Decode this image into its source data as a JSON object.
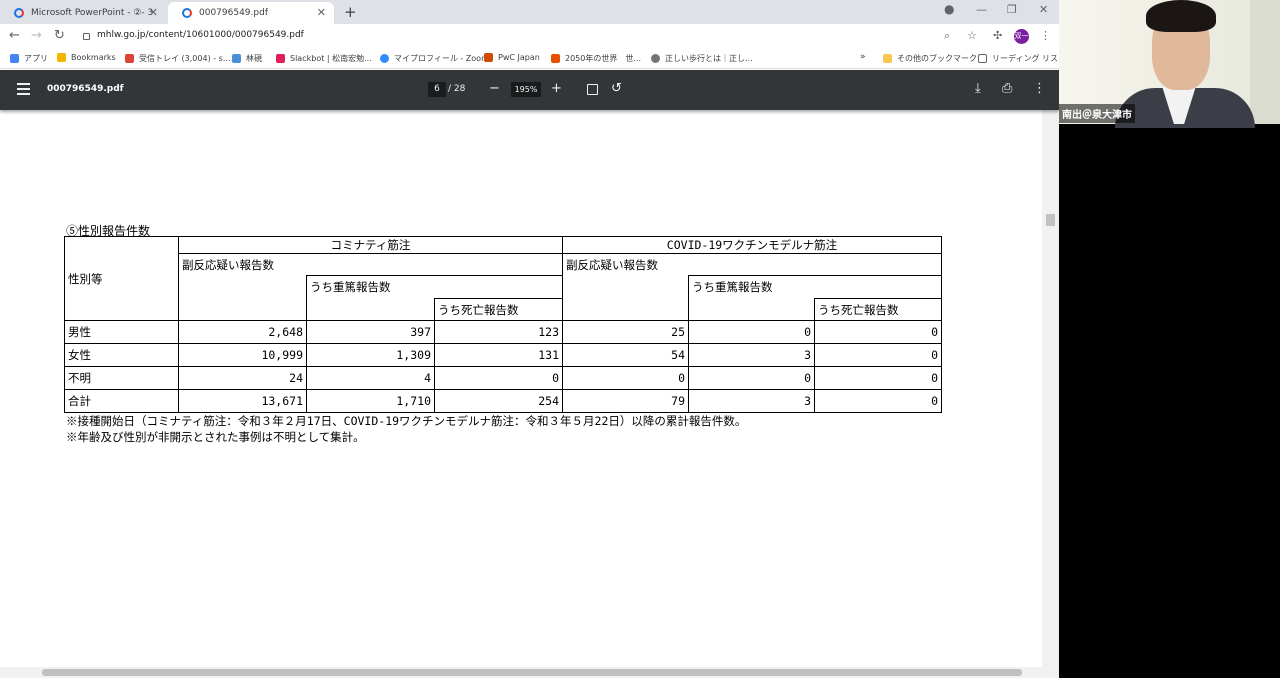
{
  "browser": {
    "tabs": [
      {
        "title": "Microsoft PowerPoint - ②- 3",
        "active": false
      },
      {
        "title": "000796549.pdf",
        "active": true
      }
    ],
    "new_tab": "+",
    "url": "mhlw.go.jp/content/10601000/000796549.pdf",
    "profile_initial": "双一",
    "bookmarks": [
      {
        "label": "アプリ",
        "color": "#4285f4"
      },
      {
        "label": "Bookmarks",
        "color": "#f4b400"
      },
      {
        "label": "受信トレイ (3,004) - s...",
        "color": "#db4437"
      },
      {
        "label": "林硯",
        "color": "#4a90d9"
      },
      {
        "label": "Slackbot | 松南宏勉...",
        "color": "#e01e5a"
      },
      {
        "label": "マイプロフィール - Zoom",
        "color": "#2d8cff"
      },
      {
        "label": "PwC Japan",
        "color": "#d04a02"
      },
      {
        "label": "2050年の世界　世...",
        "color": "#e65100"
      },
      {
        "label": "正しい歩行とは｜正し...",
        "color": "#757575"
      }
    ],
    "bookmarks_more": "»",
    "other_bookmarks": "その他のブックマーク",
    "reading_list": "リーディング リスト"
  },
  "pdf": {
    "filename": "000796549.pdf",
    "current_page": "6",
    "page_sep": "/ 28",
    "zoom": "195%",
    "zoom_out": "−",
    "zoom_in": "+"
  },
  "document": {
    "section_title": "⑤性別報告件数",
    "header": {
      "row_label": "性別等",
      "vaccine_a": "コミナティ筋注",
      "vaccine_b": "COVID-19ワクチンモデルナ筋注",
      "suspected": "副反応疑い報告数",
      "serious": "うち重篤報告数",
      "death": "うち死亡報告数"
    },
    "rows": [
      {
        "label": "男性",
        "a_suspected": "2,648",
        "a_serious": "397",
        "a_death": "123",
        "b_suspected": "25",
        "b_serious": "0",
        "b_death": "0"
      },
      {
        "label": "女性",
        "a_suspected": "10,999",
        "a_serious": "1,309",
        "a_death": "131",
        "b_suspected": "54",
        "b_serious": "3",
        "b_death": "0"
      },
      {
        "label": "不明",
        "a_suspected": "24",
        "a_serious": "4",
        "a_death": "0",
        "b_suspected": "0",
        "b_serious": "0",
        "b_death": "0"
      },
      {
        "label": "合計",
        "a_suspected": "13,671",
        "a_serious": "1,710",
        "a_death": "254",
        "b_suspected": "79",
        "b_serious": "3",
        "b_death": "0"
      }
    ],
    "notes": [
      "※接種開始日（コミナティ筋注：令和３年２月17日、COVID-19ワクチンモデルナ筋注：令和３年５月22日）以降の累計報告件数。",
      "※年齢及び性別が非開示とされた事例は不明として集計。"
    ]
  },
  "webcam": {
    "name": "南出＠泉大津市"
  }
}
